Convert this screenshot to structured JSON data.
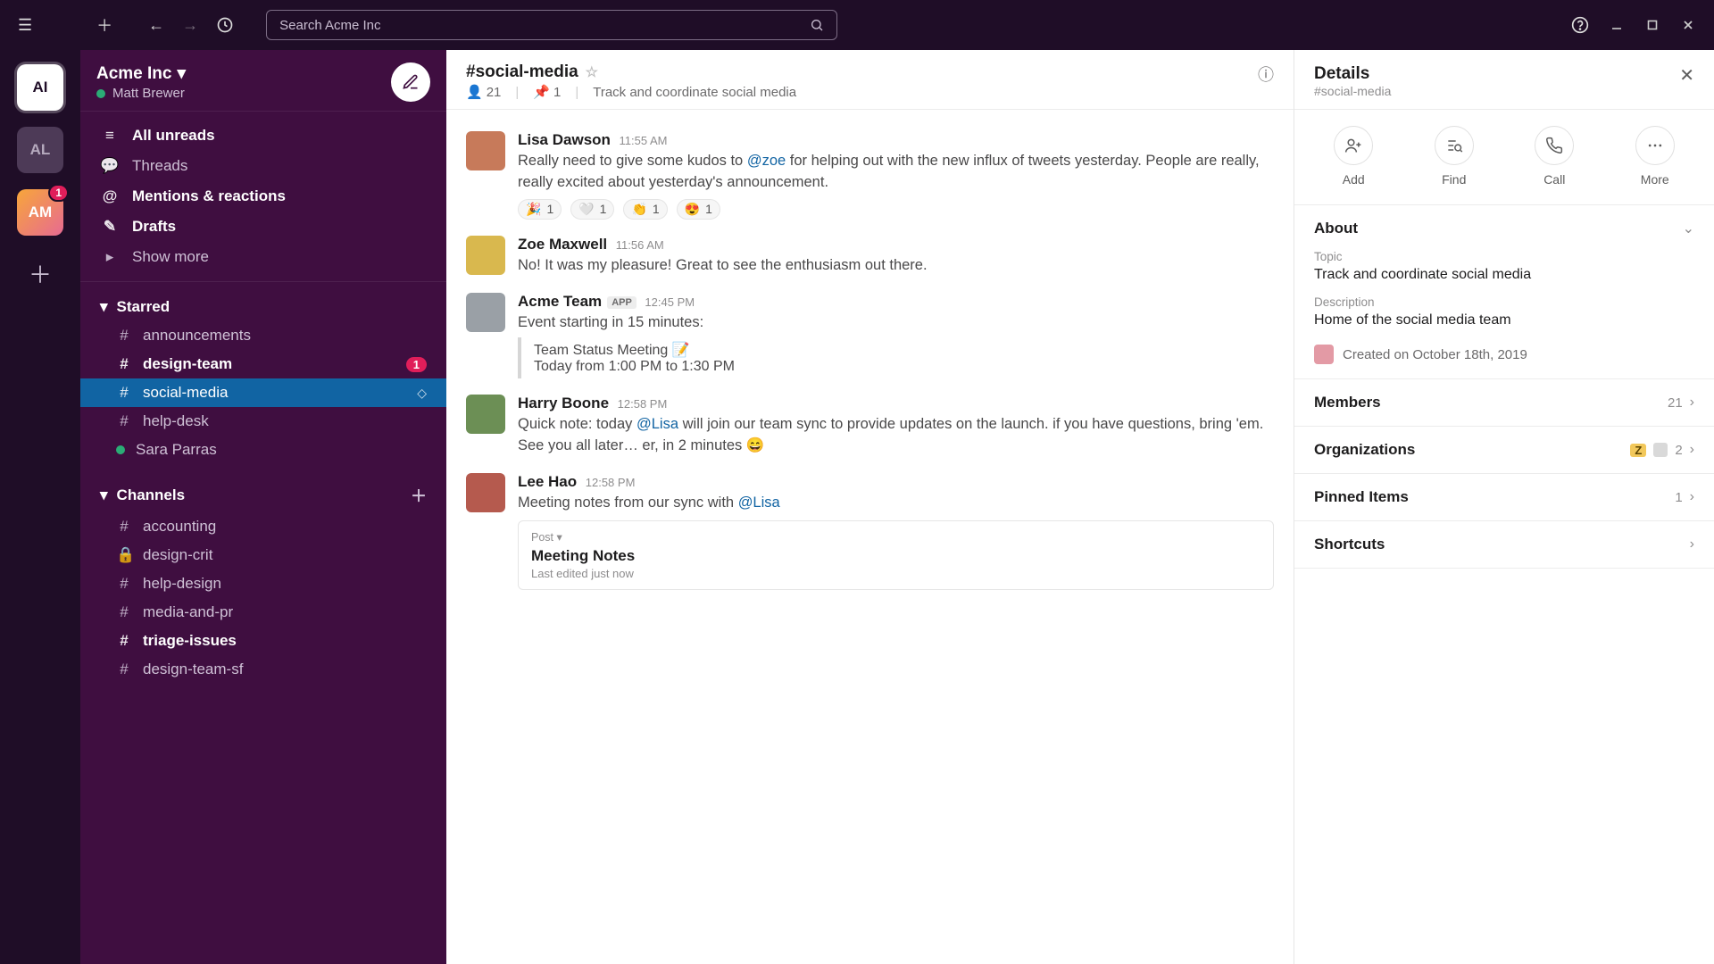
{
  "search": {
    "placeholder": "Search Acme Inc"
  },
  "rail": {
    "workspaces": [
      {
        "abbr": "AI",
        "active": true
      },
      {
        "abbr": "AL",
        "active": false
      },
      {
        "abbr": "AM",
        "active": false,
        "badge": "1"
      }
    ]
  },
  "sidebar": {
    "org_name": "Acme Inc",
    "user_name": "Matt Brewer",
    "nav": {
      "all_unreads": "All unreads",
      "threads": "Threads",
      "mentions": "Mentions & reactions",
      "drafts": "Drafts",
      "show_more": "Show more"
    },
    "starred_heading": "Starred",
    "starred": [
      {
        "prefix": "#",
        "name": "announcements"
      },
      {
        "prefix": "#",
        "name": "design-team",
        "bold": true,
        "badge": "1"
      },
      {
        "prefix": "#",
        "name": "social-media",
        "selected": true,
        "trail": "↔"
      },
      {
        "prefix": "#",
        "name": "help-desk"
      },
      {
        "prefix": "●",
        "name": "Sara Parras",
        "dm": true
      }
    ],
    "channels_heading": "Channels",
    "channels": [
      {
        "prefix": "#",
        "name": "accounting"
      },
      {
        "prefix": "🔒",
        "name": "design-crit"
      },
      {
        "prefix": "#",
        "name": "help-design"
      },
      {
        "prefix": "#",
        "name": "media-and-pr"
      },
      {
        "prefix": "#",
        "name": "triage-issues",
        "bold": true
      },
      {
        "prefix": "#",
        "name": "design-team-sf"
      }
    ]
  },
  "channel": {
    "name": "#social-media",
    "star": "☆",
    "members": "21",
    "pins": "1",
    "topic_short": "Track and coordinate social media"
  },
  "messages": [
    {
      "author": "Lisa Dawson",
      "ts": "11:55 AM",
      "avatar_bg": "#c77a5a",
      "body_parts": [
        "Really need to give some kudos to ",
        {
          "mention": "@zoe"
        },
        " for helping out with the new influx of tweets yesterday. People are really, really excited about yesterday's announcement."
      ],
      "reactions": [
        {
          "emoji": "🎉",
          "count": "1"
        },
        {
          "emoji": "🤍",
          "count": "1"
        },
        {
          "emoji": "👏",
          "count": "1"
        },
        {
          "emoji": "😍",
          "count": "1"
        }
      ]
    },
    {
      "author": "Zoe Maxwell",
      "ts": "11:56 AM",
      "avatar_bg": "#d9b84e",
      "body_parts": [
        "No! It was my pleasure! Great to see the enthusiasm out there."
      ]
    },
    {
      "author": "Acme Team",
      "app": "APP",
      "ts": "12:45 PM",
      "avatar_bg": "#9aa0a6",
      "body_parts": [
        "Event starting in 15 minutes:"
      ],
      "event": {
        "title": "Team Status Meeting 📝",
        "when": "Today from 1:00 PM to 1:30 PM"
      }
    },
    {
      "author": "Harry Boone",
      "ts": "12:58 PM",
      "avatar_bg": "#6c8f55",
      "body_parts": [
        "Quick note: today ",
        {
          "mention": "@Lisa"
        },
        " will join our team sync to provide updates on the launch. if you have questions, bring 'em. See you all later… er, in 2 minutes 😄"
      ]
    },
    {
      "author": "Lee Hao",
      "ts": "12:58 PM",
      "avatar_bg": "#b55a4e",
      "body_parts": [
        "Meeting notes from our sync with ",
        {
          "mention": "@Lisa"
        }
      ],
      "attachment": {
        "type": "Post ▾",
        "title": "Meeting Notes",
        "meta": "Last edited just now"
      }
    }
  ],
  "details": {
    "title": "Details",
    "subtitle": "#social-media",
    "actions": {
      "add": "Add",
      "find": "Find",
      "call": "Call",
      "more": "More"
    },
    "about": {
      "heading": "About",
      "topic_label": "Topic",
      "topic": "Track and coordinate social media",
      "desc_label": "Description",
      "desc": "Home of the social media team",
      "created": "Created on October 18th, 2019"
    },
    "members_label": "Members",
    "members_count": "21",
    "orgs_label": "Organizations",
    "orgs_chip": "Z",
    "orgs_count": "2",
    "pinned_label": "Pinned Items",
    "pinned_count": "1",
    "shortcuts_label": "Shortcuts"
  }
}
